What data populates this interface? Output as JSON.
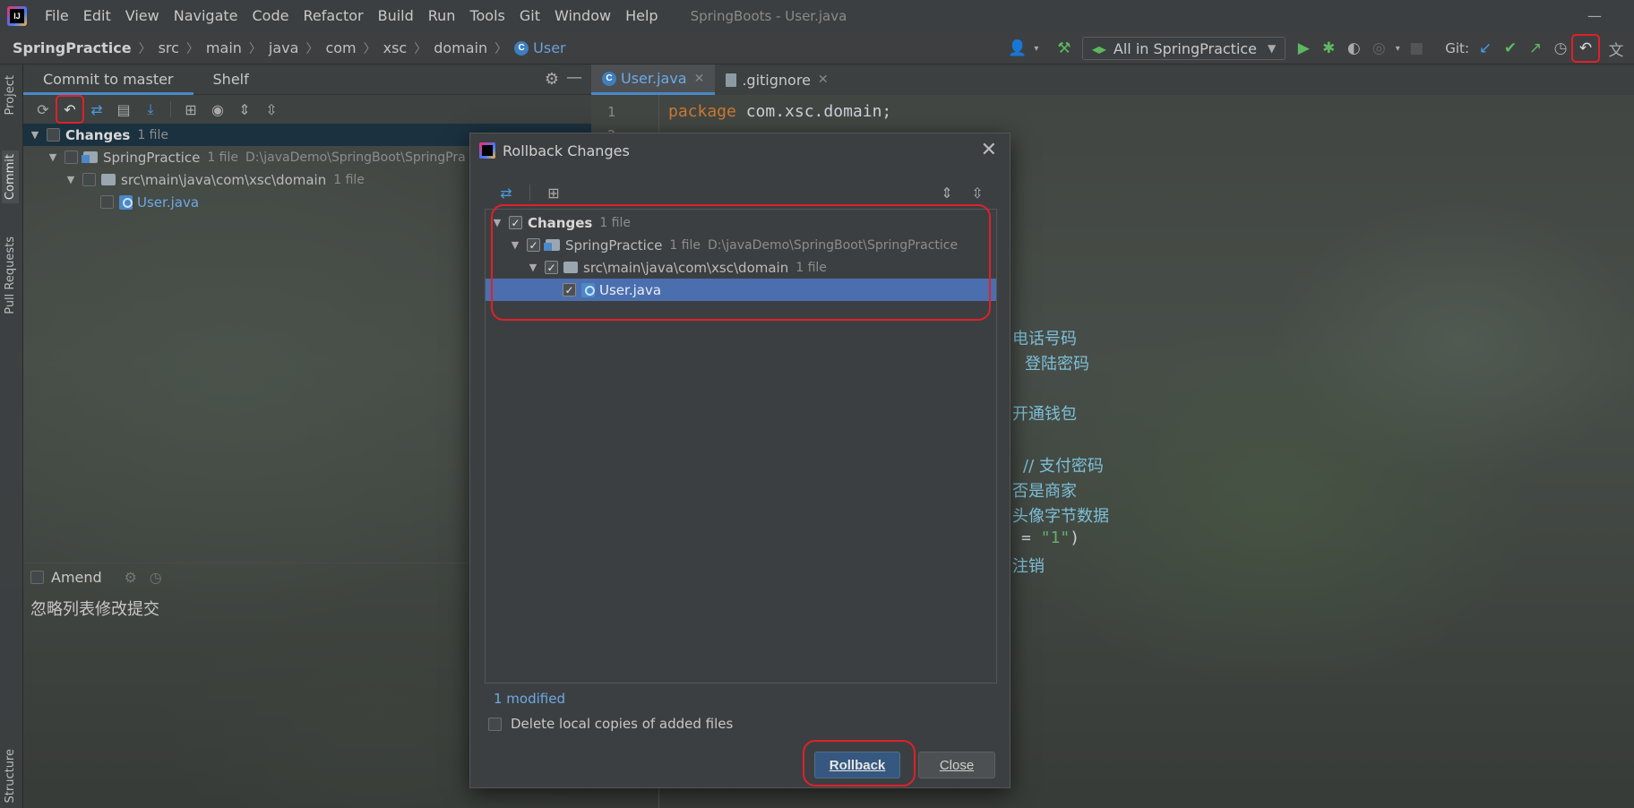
{
  "menubar": {
    "items": [
      "File",
      "Edit",
      "View",
      "Navigate",
      "Code",
      "Refactor",
      "Build",
      "Run",
      "Tools",
      "Git",
      "Window",
      "Help"
    ],
    "window_title": "SpringBoots - User.java"
  },
  "navbar": {
    "breadcrumbs": [
      "SpringPractice",
      "src",
      "main",
      "java",
      "com",
      "xsc",
      "domain",
      "User"
    ],
    "run_config": "All in SpringPractice",
    "git_label": "Git:"
  },
  "left_stripe": {
    "tabs": [
      "Project",
      "Commit",
      "Pull Requests",
      "Structure"
    ]
  },
  "commit_panel": {
    "tabs": [
      "Commit to master",
      "Shelf"
    ],
    "tree": {
      "root_label": "Changes",
      "root_count": "1 file",
      "module_label": "SpringPractice",
      "module_count": "1 file",
      "module_path": "D:\\javaDemo\\SpringBoot\\SpringPra",
      "folder_label": "src\\main\\java\\com\\xsc\\domain",
      "folder_count": "1 file",
      "file_label": "User.java"
    },
    "amend_label": "Amend",
    "commit_message": "忽略列表修改提交"
  },
  "editor": {
    "tabs": [
      {
        "label": "User.java",
        "icon": "java-class-icon"
      },
      {
        "label": ".gitignore",
        "icon": "gitignore-file-icon"
      }
    ],
    "line_numbers": [
      "1",
      "2"
    ],
    "line1_keyword": "package",
    "line1_rest": " com.xsc.domain;",
    "fragments": {
      "phone": "电话号码",
      "login_pwd": "登陆密码",
      "wallet": "开通钱包",
      "pay_pwd_prefix": "// ",
      "pay_pwd": "支付密码",
      "merchant": "否是商家",
      "avatar": "头像字节数据",
      "eq_prefix": "= ",
      "eq_value": "\"1\"",
      "eq_suffix": ")",
      "logout": "注销"
    }
  },
  "dialog": {
    "title": "Rollback Changes",
    "tree": {
      "root_label": "Changes",
      "root_count": "1 file",
      "module_label": "SpringPractice",
      "module_count": "1 file",
      "module_path": "D:\\javaDemo\\SpringBoot\\SpringPractice",
      "folder_label": "src\\main\\java\\com\\xsc\\domain",
      "folder_count": "1 file",
      "file_label": "User.java"
    },
    "modified_label": "1 modified",
    "delete_label": "Delete local copies of added files",
    "rollback_button": "Rollback",
    "close_button": "Close"
  },
  "colors": {
    "accent": "#4a88c7",
    "selection": "#4b6eaf",
    "annotation_red": "#e0202a",
    "primary_button": "#365880"
  }
}
